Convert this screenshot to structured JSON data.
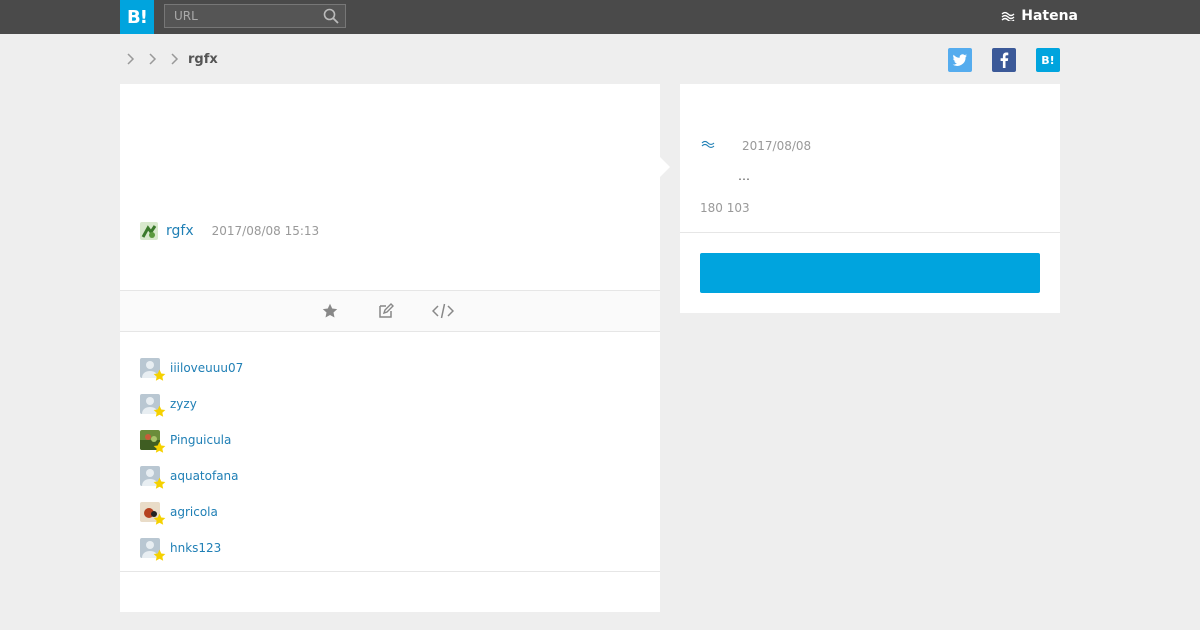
{
  "header": {
    "logo_label": "B!",
    "search_placeholder": "URL",
    "brand_label": "Hatena"
  },
  "breadcrumb": {
    "current": "rgfx"
  },
  "entry": {
    "user": "rgfx",
    "timestamp": "2017/08/08 15:13"
  },
  "stars": [
    {
      "name": "iiiloveuuu07"
    },
    {
      "name": "zyzy"
    },
    {
      "name": "Pinguicula"
    },
    {
      "name": "aquatofana"
    },
    {
      "name": "agricola"
    },
    {
      "name": "hnks123"
    }
  ],
  "side": {
    "date": "2017/08/08",
    "excerpt": "…",
    "counts": "180 103",
    "cta_label": ""
  },
  "colors": {
    "accent": "#00a4de",
    "link": "#1f7fb5",
    "topbar": "#4a4a4a"
  }
}
